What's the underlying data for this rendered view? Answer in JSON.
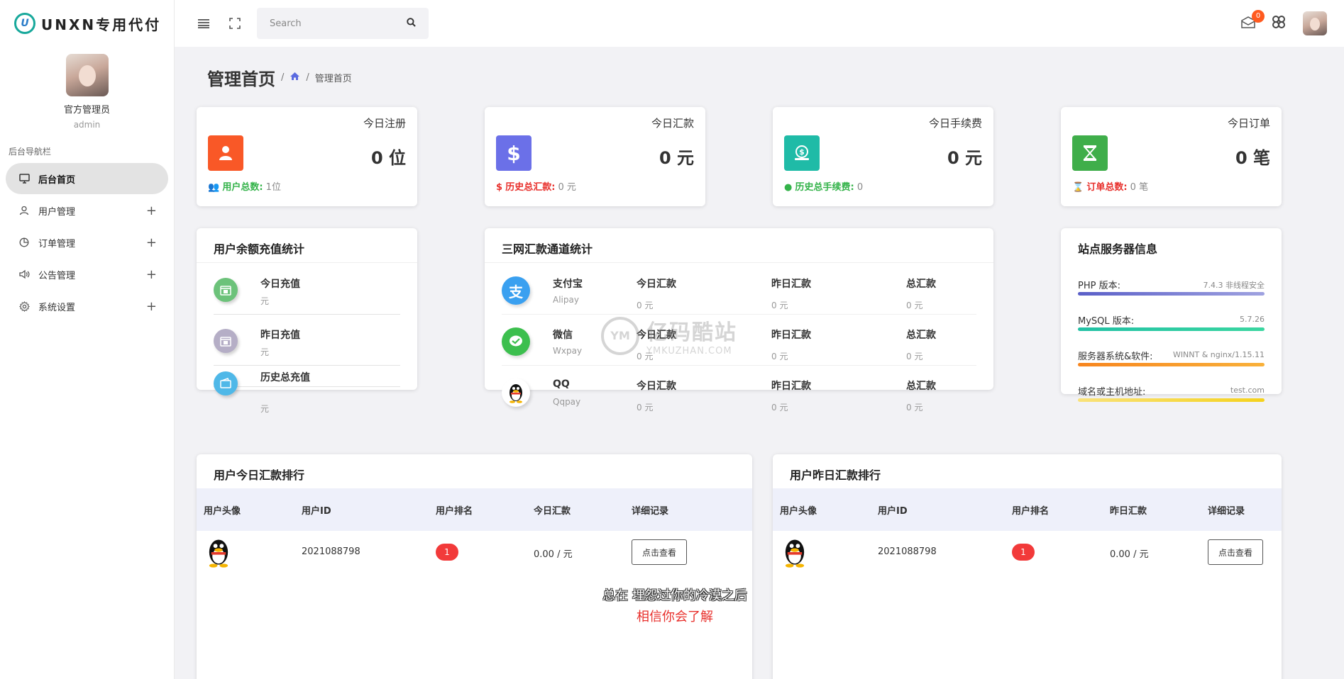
{
  "brand": {
    "logo_letter": "U",
    "name": "UNXN专用代付"
  },
  "profile": {
    "name": "官方管理员",
    "role": "admin"
  },
  "sidebar": {
    "section_title": "后台导航栏",
    "items": [
      {
        "label": "后台首页",
        "icon": "monitor-icon",
        "active": true
      },
      {
        "label": "用户管理",
        "icon": "user-icon",
        "expandable": "+"
      },
      {
        "label": "订单管理",
        "icon": "pie-chart-icon",
        "expandable": "+"
      },
      {
        "label": "公告管理",
        "icon": "speaker-icon",
        "expandable": "+"
      },
      {
        "label": "系统设置",
        "icon": "gear-icon",
        "expandable": "+"
      }
    ]
  },
  "topbar": {
    "search_placeholder": "Search",
    "mail_count": "0"
  },
  "page": {
    "title": "管理首页",
    "breadcrumb_sep": "/",
    "breadcrumb_current": "管理首页"
  },
  "stats": [
    {
      "title": "今日注册",
      "value": "0 位",
      "foot_label": "用户总数:",
      "foot_value": "1位",
      "color": "#f95827",
      "foot_color": "#34b34a"
    },
    {
      "title": "今日汇款",
      "value": "0 元",
      "foot_label": "历史总汇款:",
      "foot_value": "0 元",
      "color": "#6b70e8",
      "foot_color": "#e8302c"
    },
    {
      "title": "今日手续费",
      "value": "0 元",
      "foot_label": "历史总手续费:",
      "foot_value": "0",
      "color": "#1fbba7",
      "foot_color": "#34b34a"
    },
    {
      "title": "今日订单",
      "value": "0 笔",
      "foot_label": "订单总数:",
      "foot_value": "0 笔",
      "color": "#3fae4a",
      "foot_color": "#e8302c"
    }
  ],
  "recharge": {
    "title": "用户余额充值统计",
    "rows": [
      {
        "label": "今日充值",
        "unit": "元",
        "color": "#6cc27a"
      },
      {
        "label": "昨日充值",
        "unit": "元",
        "color": "#b5aec6"
      },
      {
        "label": "历史总充值",
        "unit": "元",
        "color": "#4fb8e8"
      }
    ]
  },
  "channels": {
    "title": "三网汇款通道统计",
    "rows": [
      {
        "name": "支付宝",
        "sub": "Alipay",
        "today_h": "今日汇款",
        "today_v": "0 元",
        "yest_h": "昨日汇款",
        "yest_v": "0 元",
        "total_h": "总汇款",
        "total_v": "0 元"
      },
      {
        "name": "微信",
        "sub": "Wxpay",
        "today_h": "今日汇款",
        "today_v": "0 元",
        "yest_h": "昨日汇款",
        "yest_v": "0 元",
        "total_h": "总汇款",
        "total_v": "0 元"
      },
      {
        "name": "QQ",
        "sub": "Qqpay",
        "today_h": "今日汇款",
        "today_v": "0 元",
        "yest_h": "昨日汇款",
        "yest_v": "0 元",
        "total_h": "总汇款",
        "total_v": "0 元"
      }
    ]
  },
  "server": {
    "title": "站点服务器信息",
    "rows": [
      {
        "label": "PHP 版本:",
        "value": "7.4.3 非线程安全",
        "color": "#5a5fc8"
      },
      {
        "label": "MySQL 版本:",
        "value": "5.7.26",
        "color": "#22c1a5"
      },
      {
        "label": "服务器系统&软件:",
        "value": "WINNT & nginx/1.15.11",
        "color": "#f79a1e"
      },
      {
        "label": "域名或主机地址:",
        "value": "test.com",
        "color": "#f5d21c"
      }
    ]
  },
  "rank_today": {
    "title": "用户今日汇款排行",
    "headers": [
      "用户头像",
      "用户ID",
      "用户排名",
      "今日汇款",
      "详细记录"
    ],
    "row": {
      "user_id": "2021088798",
      "rank": "1",
      "amount": "0.00 / 元",
      "button": "点击查看"
    }
  },
  "rank_yesterday": {
    "title": "用户昨日汇款排行",
    "headers": [
      "用户头像",
      "用户ID",
      "用户排名",
      "昨日汇款",
      "详细记录"
    ],
    "row": {
      "user_id": "2021088798",
      "rank": "1",
      "amount": "0.00 / 元",
      "button": "点击查看"
    }
  },
  "watermark": {
    "mark": "YM",
    "line1": "亿码酷站",
    "line2": "YMKUZHAN.COM"
  },
  "subtitle": {
    "line1": "总在 埋怨过你的冷漠之后",
    "line2": "相信你会了解"
  }
}
